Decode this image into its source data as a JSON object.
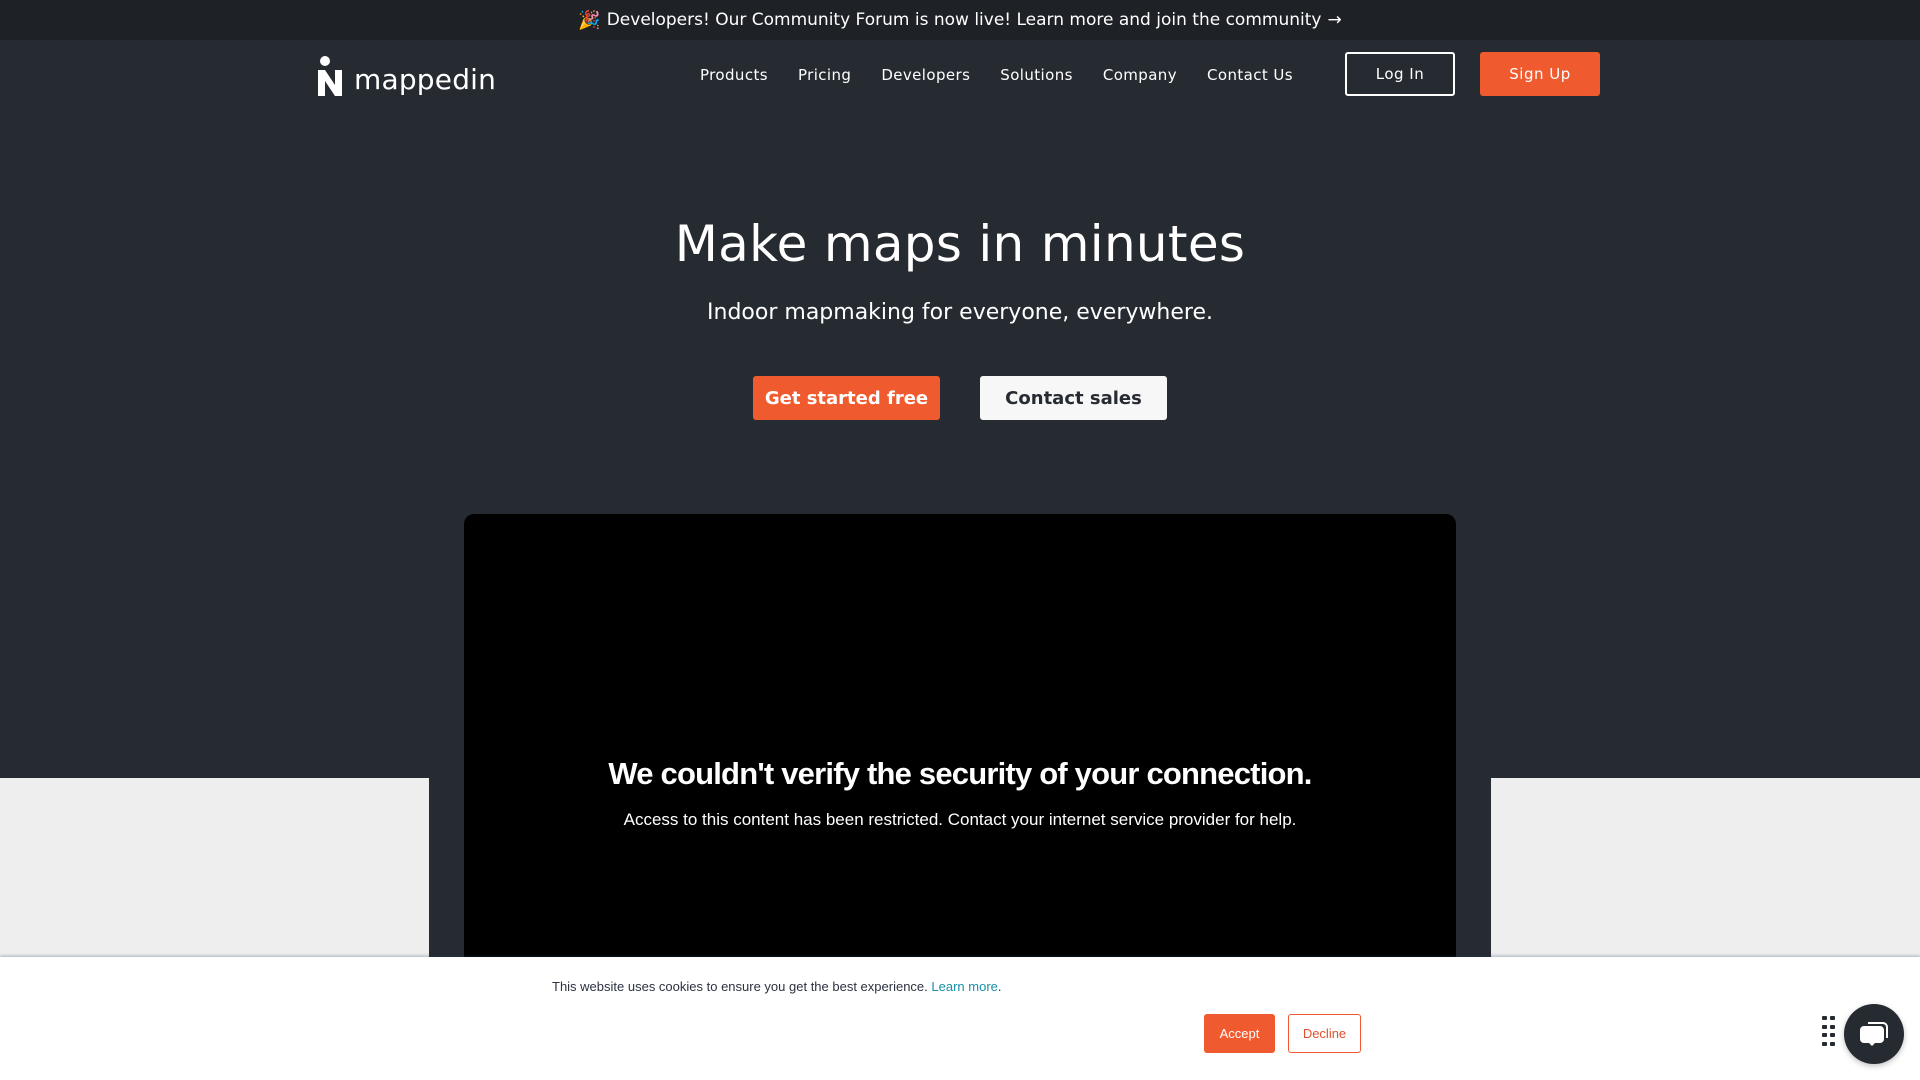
{
  "announcement": {
    "emoji": "🎉",
    "text": "Developers! Our Community Forum is now live! Learn more and join the community",
    "arrow": "→"
  },
  "nav": {
    "logo_text": "mappedin",
    "links": [
      "Products",
      "Pricing",
      "Developers",
      "Solutions",
      "Company",
      "Contact Us"
    ],
    "login_label": "Log In",
    "signup_label": "Sign Up"
  },
  "hero": {
    "title": "Make maps in minutes",
    "subtitle": "Indoor mapmaking for everyone, everywhere.",
    "primary_cta": "Get started free",
    "secondary_cta": "Contact sales"
  },
  "video": {
    "error_title": "We couldn't verify the security of your connection.",
    "error_message": "Access to this content has been restricted. Contact your internet service provider for help."
  },
  "cookie_banner": {
    "text": "This website uses cookies to ensure you get the best experience.",
    "link_label": "Learn more",
    "link_suffix": ".",
    "accept_label": "Accept",
    "decline_label": "Decline"
  },
  "chat_widget": {
    "icon": "chat-bubbles-icon",
    "handle_icon": "drag-handle-icon"
  },
  "colors": {
    "brand_orange": "#f05a2f",
    "hero_bg": "#262a31",
    "announcement_bg": "#1e2126",
    "light_section_bg": "#eeeeef",
    "cookie_link": "#1a8fa8"
  }
}
